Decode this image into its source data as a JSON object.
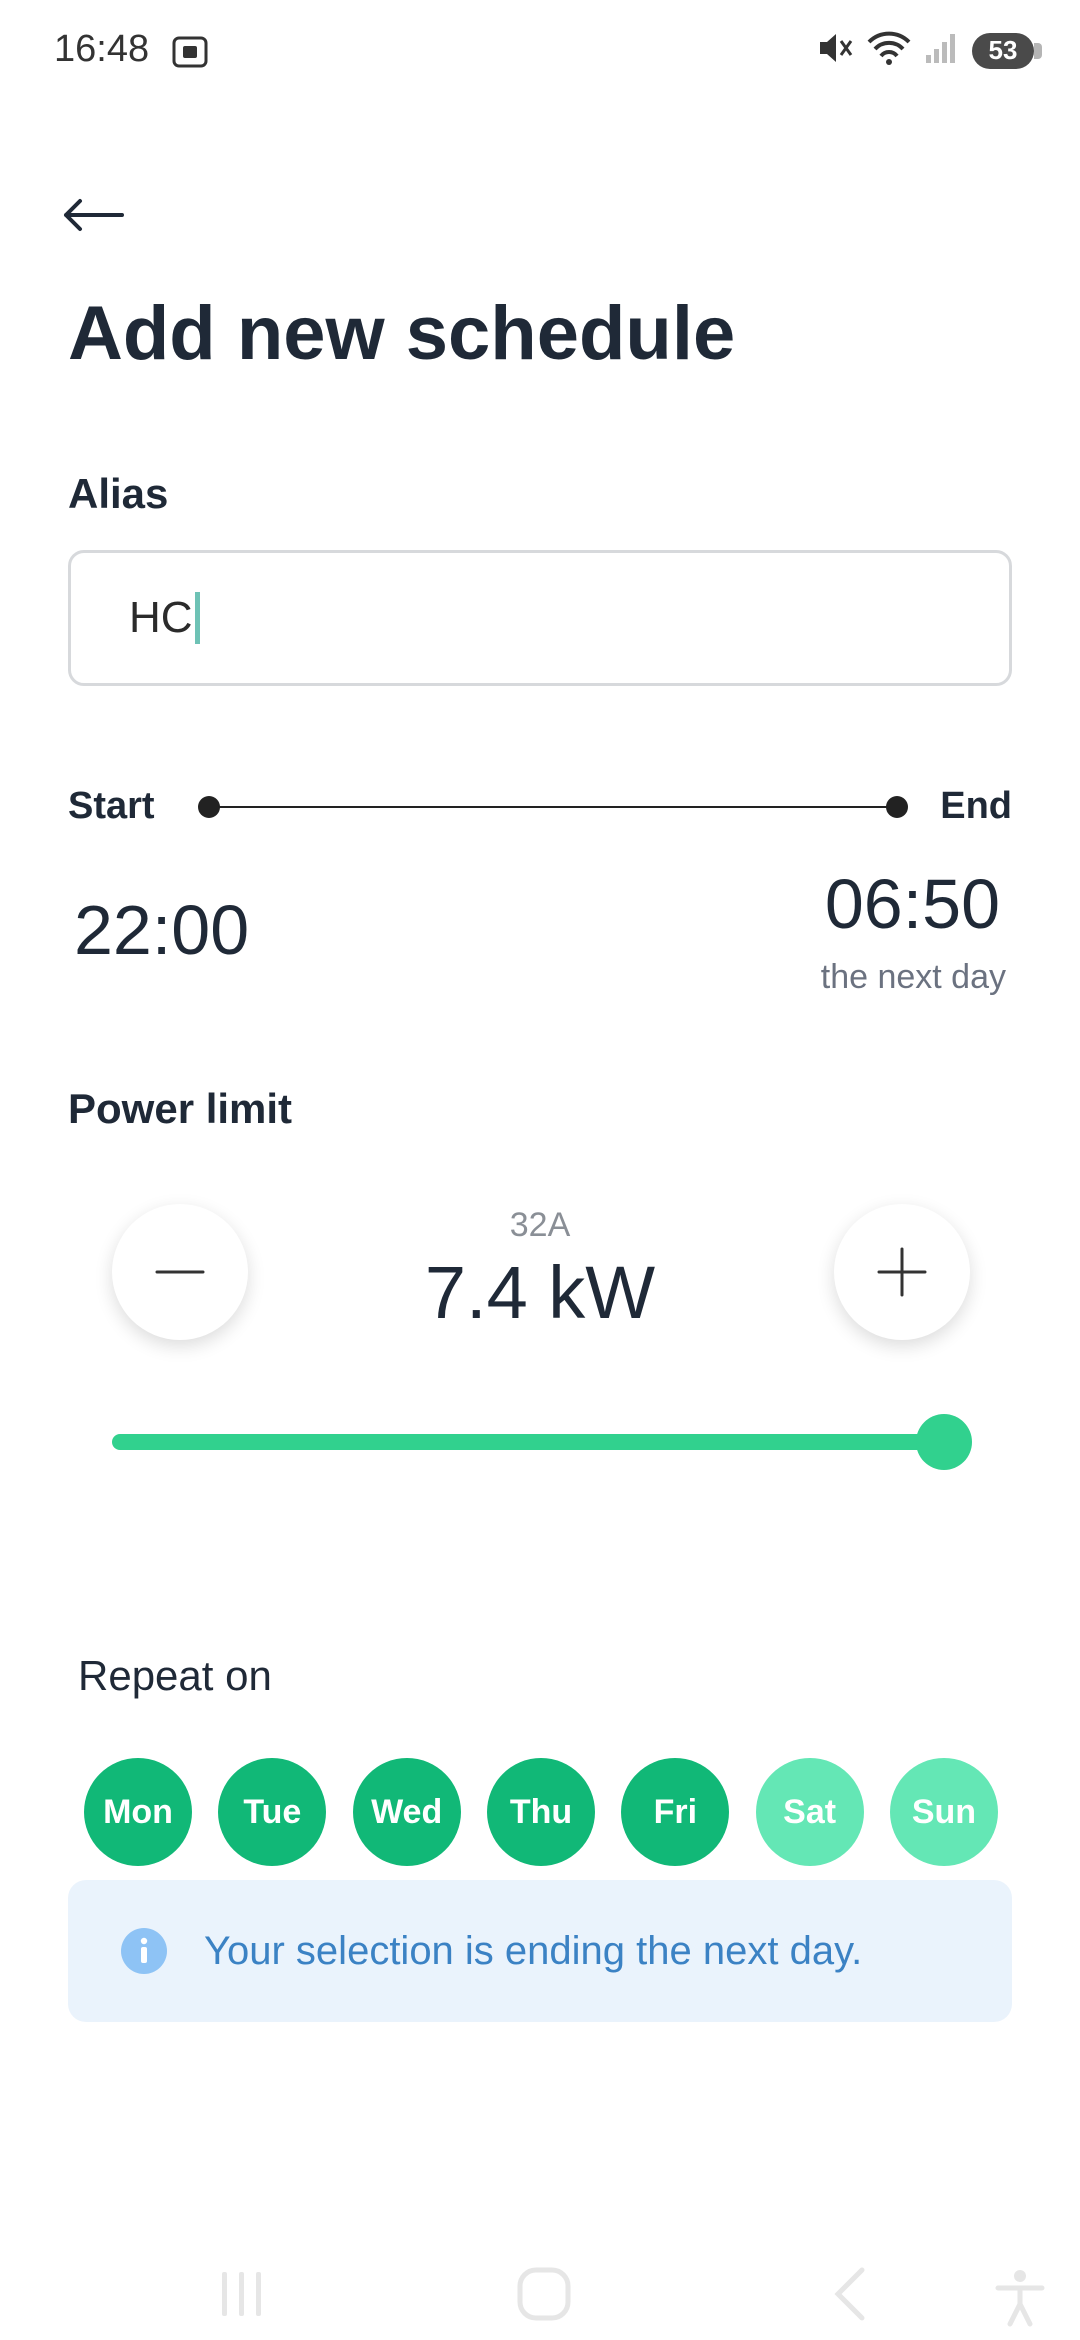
{
  "status_bar": {
    "time": "16:48",
    "battery": "53"
  },
  "header": {
    "title": "Add new schedule"
  },
  "alias": {
    "label": "Alias",
    "value": "HC"
  },
  "timeline": {
    "start_label": "Start",
    "end_label": "End",
    "start_time": "22:00",
    "end_time": "06:50",
    "end_note": "the next day"
  },
  "power": {
    "label": "Power limit",
    "amps": "32A",
    "kw": "7.4 kW",
    "slider_level_percent": 100
  },
  "repeat": {
    "label": "Repeat on",
    "days": [
      {
        "label": "Mon",
        "selected": true
      },
      {
        "label": "Tue",
        "selected": true
      },
      {
        "label": "Wed",
        "selected": true
      },
      {
        "label": "Thu",
        "selected": true
      },
      {
        "label": "Fri",
        "selected": true
      },
      {
        "label": "Sat",
        "selected": false
      },
      {
        "label": "Sun",
        "selected": false
      }
    ]
  },
  "info": {
    "text": "Your selection is ending the next day."
  },
  "colors": {
    "accent": "#31d18e",
    "day_selected": "#11b877",
    "day_unselected": "#64e7b5",
    "info_bg": "#eaf3fc",
    "info_text": "#3b82c4"
  }
}
